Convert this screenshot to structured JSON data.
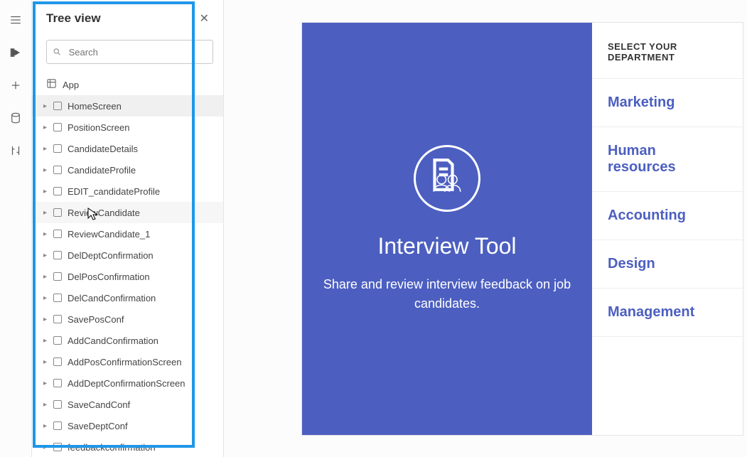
{
  "tree": {
    "title": "Tree view",
    "search_placeholder": "Search",
    "app_label": "App",
    "screens": [
      {
        "name": "HomeScreen",
        "state": "selected"
      },
      {
        "name": "PositionScreen",
        "state": ""
      },
      {
        "name": "CandidateDetails",
        "state": ""
      },
      {
        "name": "CandidateProfile",
        "state": ""
      },
      {
        "name": "EDIT_candidateProfile",
        "state": ""
      },
      {
        "name": "ReviewCandidate",
        "state": "hovered"
      },
      {
        "name": "ReviewCandidate_1",
        "state": ""
      },
      {
        "name": "DelDeptConfirmation",
        "state": ""
      },
      {
        "name": "DelPosConfirmation",
        "state": ""
      },
      {
        "name": "DelCandConfirmation",
        "state": ""
      },
      {
        "name": "SavePosConf",
        "state": ""
      },
      {
        "name": "AddCandConfirmation",
        "state": ""
      },
      {
        "name": "AddPosConfirmationScreen",
        "state": ""
      },
      {
        "name": "AddDeptConfirmationScreen",
        "state": ""
      },
      {
        "name": "SaveCandConf",
        "state": ""
      },
      {
        "name": "SaveDeptConf",
        "state": ""
      },
      {
        "name": "feedbackconfirmation",
        "state": ""
      }
    ]
  },
  "preview": {
    "title": "Interview Tool",
    "subtitle": "Share and review interview feedback on job candidates.",
    "select_header": "SELECT YOUR DEPARTMENT",
    "departments": [
      "Marketing",
      "Human resources",
      "Accounting",
      "Design",
      "Management"
    ]
  }
}
